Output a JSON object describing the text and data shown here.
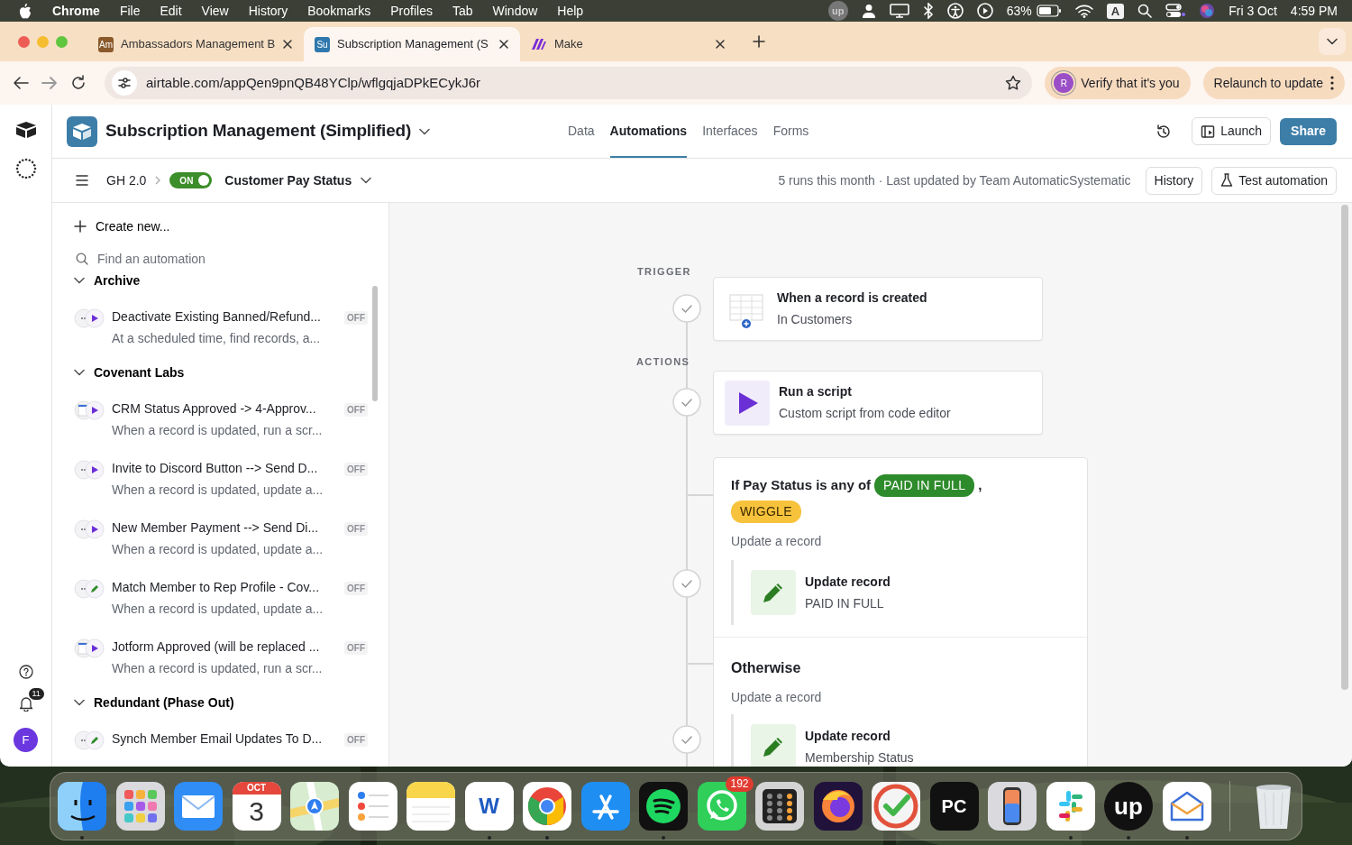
{
  "menubar": {
    "app": "Chrome",
    "menus": [
      "File",
      "Edit",
      "View",
      "History",
      "Bookmarks",
      "Profiles",
      "Tab",
      "Window",
      "Help"
    ],
    "status_glyph": "up",
    "battery": "63%",
    "input_source": "A",
    "date": "Fri 3 Oct",
    "time": "4:59 PM"
  },
  "browser": {
    "tabs": [
      {
        "kind": "letters",
        "favicon": "Am",
        "color": "#8a5a2b",
        "title": "Ambassadors Management B",
        "selected": false
      },
      {
        "kind": "letters",
        "favicon": "Su",
        "color": "#2f78ad",
        "title": "Subscription Management (S",
        "selected": true
      },
      {
        "kind": "logo",
        "title": "Make",
        "selected": false
      }
    ],
    "url": "airtable.com/appQen9pnQB48YClp/wflgqjaDPkECykJ6r",
    "verify_avatar": "R",
    "verify": "Verify that it's you",
    "relaunch": "Relaunch to update"
  },
  "rail": {
    "notifications": "11",
    "avatar": "F"
  },
  "app": {
    "title": "Subscription Management (Simplified)",
    "nav": [
      {
        "label": "Data",
        "selected": false
      },
      {
        "label": "Automations",
        "selected": true
      },
      {
        "label": "Interfaces",
        "selected": false
      },
      {
        "label": "Forms",
        "selected": false
      }
    ],
    "launch": "Launch",
    "share": "Share"
  },
  "toolbar": {
    "breadcrumb": "GH 2.0",
    "toggle": {
      "label": "ON",
      "on": true
    },
    "automation": "Customer Pay Status",
    "summary": "5 runs this month · Last updated by Team AutomaticSystematic",
    "history": "History",
    "test": "Test automation"
  },
  "sidebar": {
    "create": "Create new...",
    "search_placeholder": "Find an automation",
    "groups": [
      {
        "name": "Archive",
        "expanded": true,
        "items": [
          {
            "trigger": {
              "kind": "dots"
            },
            "action": {
              "kind": "script"
            },
            "title": "Deactivate Existing Banned/Refund...",
            "subtitle": "At a scheduled time, find records, a...",
            "status": "OFF"
          }
        ]
      },
      {
        "name": "Covenant Labs",
        "expanded": true,
        "items": [
          {
            "trigger": {
              "kind": "form"
            },
            "action": {
              "kind": "script"
            },
            "title": "CRM Status Approved -> 4-Approv...",
            "subtitle": "When a record is updated, run a scr...",
            "status": "OFF"
          },
          {
            "trigger": {
              "kind": "dots"
            },
            "action": {
              "kind": "script"
            },
            "title": "Invite to Discord Button --> Send D...",
            "subtitle": "When a record is updated, update a...",
            "status": "OFF"
          },
          {
            "trigger": {
              "kind": "dots"
            },
            "action": {
              "kind": "script"
            },
            "title": "New Member Payment --> Send Di...",
            "subtitle": "When a record is updated, update a...",
            "status": "OFF"
          },
          {
            "trigger": {
              "kind": "dots"
            },
            "action": {
              "kind": "update"
            },
            "title": "Match Member to Rep Profile - Cov...",
            "subtitle": "When a record is updated, update a...",
            "status": "OFF"
          },
          {
            "trigger": {
              "kind": "form"
            },
            "action": {
              "kind": "script"
            },
            "title": "Jotform Approved (will be replaced ...",
            "subtitle": "When a record is updated, run a scr...",
            "status": "OFF"
          }
        ]
      },
      {
        "name": "Redundant (Phase Out)",
        "expanded": true,
        "items": [
          {
            "trigger": {
              "kind": "dots"
            },
            "action": {
              "kind": "update"
            },
            "title": "Synch Member Email Updates To D...",
            "status": "OFF"
          }
        ]
      }
    ]
  },
  "workflow": {
    "trigger_label": "TRIGGER",
    "actions_label": "ACTIONS",
    "trigger": {
      "title": "When a record is created",
      "subtitle": "In Customers"
    },
    "actions": [
      {
        "kind": "script",
        "title": "Run a script",
        "subtitle": "Custom script from code editor"
      }
    ],
    "condition": {
      "prefix": "If Pay Status is any of",
      "values": [
        {
          "label": "PAID IN FULL",
          "color": "#2e8b2b"
        },
        {
          "label": "WIGGLE",
          "color": "#f8c33c"
        }
      ],
      "separator": ",",
      "action_label": "Update a record",
      "step": {
        "title": "Update record",
        "subtitle": "PAID IN FULL"
      }
    },
    "otherwise": {
      "title": "Otherwise",
      "action_label": "Update a record",
      "step": {
        "title": "Update record",
        "subtitle": "Membership Status"
      }
    }
  },
  "dock": [
    {
      "kind": "finder",
      "running": true
    },
    {
      "kind": "launchpad",
      "running": false
    },
    {
      "kind": "mail",
      "running": false
    },
    {
      "kind": "calendar",
      "month": "OCT",
      "day": "3",
      "running": false
    },
    {
      "kind": "maps",
      "running": false
    },
    {
      "kind": "reminders",
      "running": false
    },
    {
      "kind": "notes",
      "running": false
    },
    {
      "kind": "word",
      "glyph": "W",
      "running": true
    },
    {
      "kind": "chrome",
      "running": true
    },
    {
      "kind": "appstore",
      "running": false
    },
    {
      "kind": "spotify",
      "running": true
    },
    {
      "kind": "whatsapp",
      "badge": "192",
      "running": false
    },
    {
      "kind": "calculator",
      "running": false
    },
    {
      "kind": "firefox",
      "running": false
    },
    {
      "kind": "tasks",
      "running": false
    },
    {
      "kind": "pycharm",
      "glyph": "PC",
      "running": false
    },
    {
      "kind": "phone",
      "running": false
    },
    {
      "kind": "slack",
      "running": true
    },
    {
      "kind": "upwork",
      "glyph": "up",
      "running": true
    },
    {
      "kind": "mailbox",
      "running": true
    },
    {
      "kind": "trash",
      "running": false
    }
  ]
}
